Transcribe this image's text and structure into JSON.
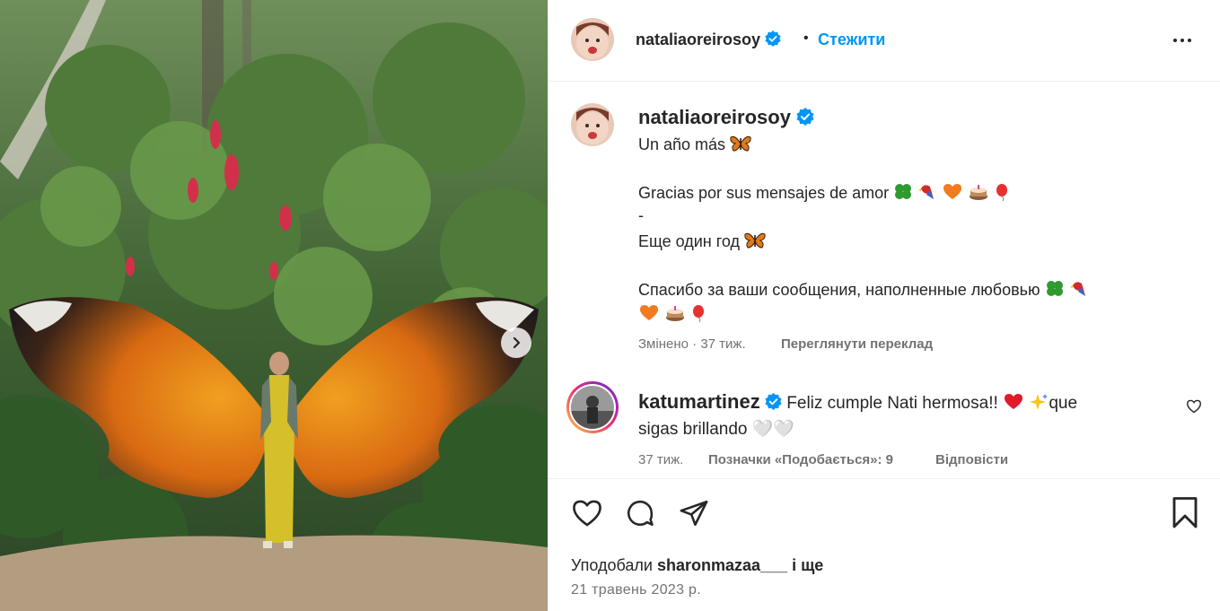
{
  "post": {
    "author": "nataliaoreirosoy",
    "follow_label": "Стежити",
    "separator": "•"
  },
  "caption": {
    "author": "nataliaoreirosoy",
    "lines": [
      "Un año más",
      "Gracias por sus mensajes de amor",
      "-",
      "Еще один год",
      "Спасибо за ваши сообщения, наполненные любовью"
    ],
    "edited_label": "Змінено",
    "time": "37 тиж.",
    "translate_label": "Переглянути переклад"
  },
  "comment": {
    "author": "katumartinez",
    "text_start": "Feliz cumple Nati hermosa!!",
    "text_mid": "que",
    "text_line2": "sigas brillando",
    "text_tail": "🤍🤍",
    "time": "37 тиж.",
    "likes_label": "Позначки «Подобається»: 9",
    "reply_label": "Відповісти"
  },
  "footer": {
    "liked_by_prefix": "Уподобали",
    "liked_by_user": "sharonmazaa___",
    "liked_by_suffix": "і ще",
    "date": "21 травень 2023 р."
  },
  "icons": {
    "heart": "heart-icon",
    "comment": "comment-icon",
    "share": "share-icon",
    "save": "bookmark-icon",
    "more": "more-options-icon",
    "verified": "verified-badge-icon",
    "next": "chevron-right-icon"
  },
  "colors": {
    "accent": "#0095f6",
    "verified": "#0095f6",
    "muted": "#737373",
    "text": "#262626"
  }
}
